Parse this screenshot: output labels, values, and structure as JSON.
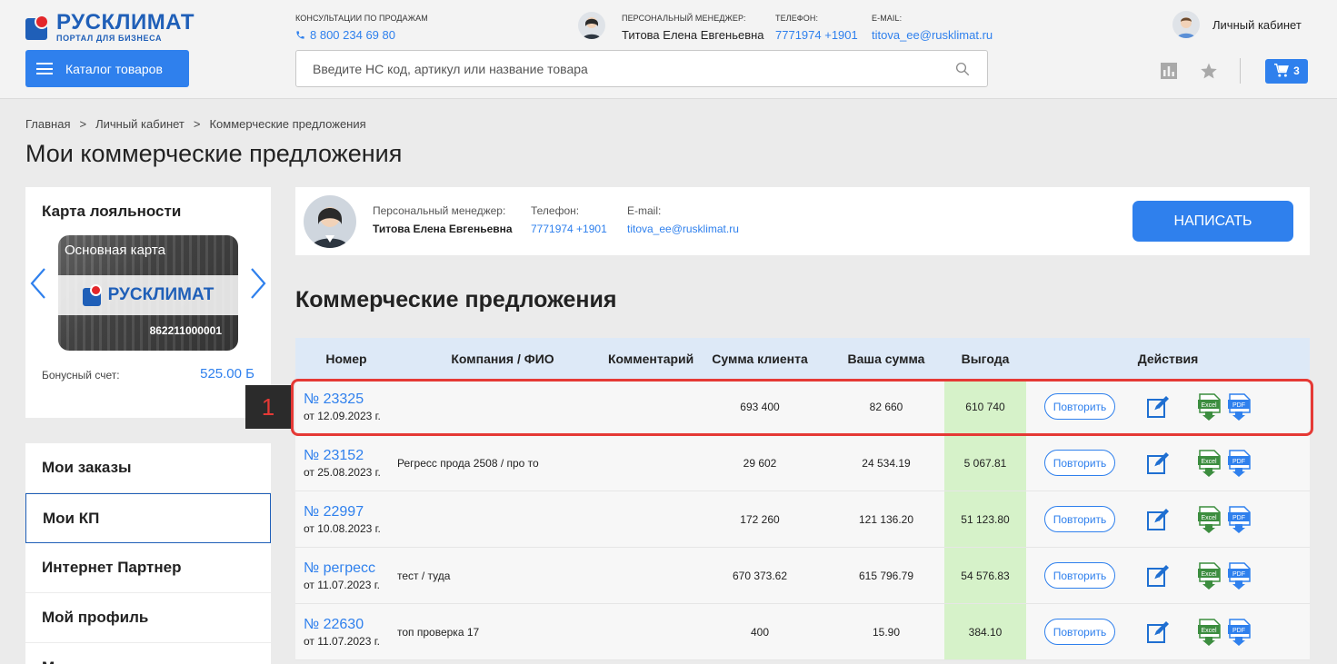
{
  "header": {
    "logo_name": "РУСКЛИМАТ",
    "logo_sub": "ПОРТАЛ ДЛЯ БИЗНЕСА",
    "catalog_label": "Каталог товаров",
    "consult_label": "КОНСУЛЬТАЦИИ ПО ПРОДАЖАМ",
    "consult_phone": "8 800 234 69 80",
    "manager_label": "ПЕРСОНАЛЬНЫЙ МЕНЕДЖЕР:",
    "manager_name": "Титова Елена Евгеньевна",
    "phone_label": "ТЕЛЕФОН:",
    "phone_value": "7771974 +1901",
    "email_label": "E-MAIL:",
    "email_value": "titova_ee@rusklimat.ru",
    "cabinet_label": "Личный кабинет",
    "search_placeholder": "Введите НС код, артикул или название товара",
    "cart_count": "3",
    "accent_color": "#2f80ed"
  },
  "breadcrumb": [
    "Главная",
    ">",
    "Личный кабинет",
    ">",
    "Коммерческие предложения"
  ],
  "page_title": "Мои коммерческие предложения",
  "loyalty": {
    "title": "Карта лояльности",
    "card_name": "Основная карта",
    "card_brand": "РУСКЛИМАТ",
    "card_number": "862211000001",
    "bonus_label": "Бонусный счет:",
    "bonus_value": "525.00 Б"
  },
  "menu": {
    "items": [
      {
        "label": "Мои заказы"
      },
      {
        "label": "Мои КП"
      },
      {
        "label": "Интернет Партнер"
      },
      {
        "label": "Мой профиль"
      },
      {
        "label": "М..."
      }
    ]
  },
  "manager_panel": {
    "manager_label": "Персональный менеджер:",
    "manager_name": "Титова Елена Евгеньевна",
    "phone_label": "Телефон:",
    "phone_value": "7771974 +1901",
    "email_label": "E-mail:",
    "email_value": "titova_ee@rusklimat.ru",
    "write_button": "НАПИСАТЬ"
  },
  "section_title": "Коммерческие предложения",
  "table": {
    "headers": [
      "Номер",
      "Компания / ФИО",
      "Комментарий",
      "Сумма клиента",
      "Ваша сумма",
      "Выгода",
      "Действия"
    ],
    "repeat_label": "Повторить",
    "rows": [
      {
        "number": "№ 23325",
        "date": "от 12.09.2023 г.",
        "company": "",
        "comment": "",
        "client_sum": "693 400",
        "your_sum": "82 660",
        "benefit": "610 740"
      },
      {
        "number": "№ 23152",
        "date": "от 25.08.2023 г.",
        "company": "Регресс прода 2508 / про то",
        "comment": "",
        "client_sum": "29 602",
        "your_sum": "24 534.19",
        "benefit": "5 067.81"
      },
      {
        "number": "№ 22997",
        "date": "от 10.08.2023 г.",
        "company": "",
        "comment": "",
        "client_sum": "172 260",
        "your_sum": "121 136.20",
        "benefit": "51 123.80"
      },
      {
        "number": "№ регресс",
        "date": "от 11.07.2023 г.",
        "company": "тест / туда",
        "comment": "",
        "client_sum": "670 373.62",
        "your_sum": "615 796.79",
        "benefit": "54 576.83"
      },
      {
        "number": "№ 22630",
        "date": "от 11.07.2023 г.",
        "company": "топ проверка 17",
        "comment": "",
        "client_sum": "400",
        "your_sum": "15.90",
        "benefit": "384.10"
      }
    ]
  },
  "annotation": {
    "marker": "1"
  }
}
